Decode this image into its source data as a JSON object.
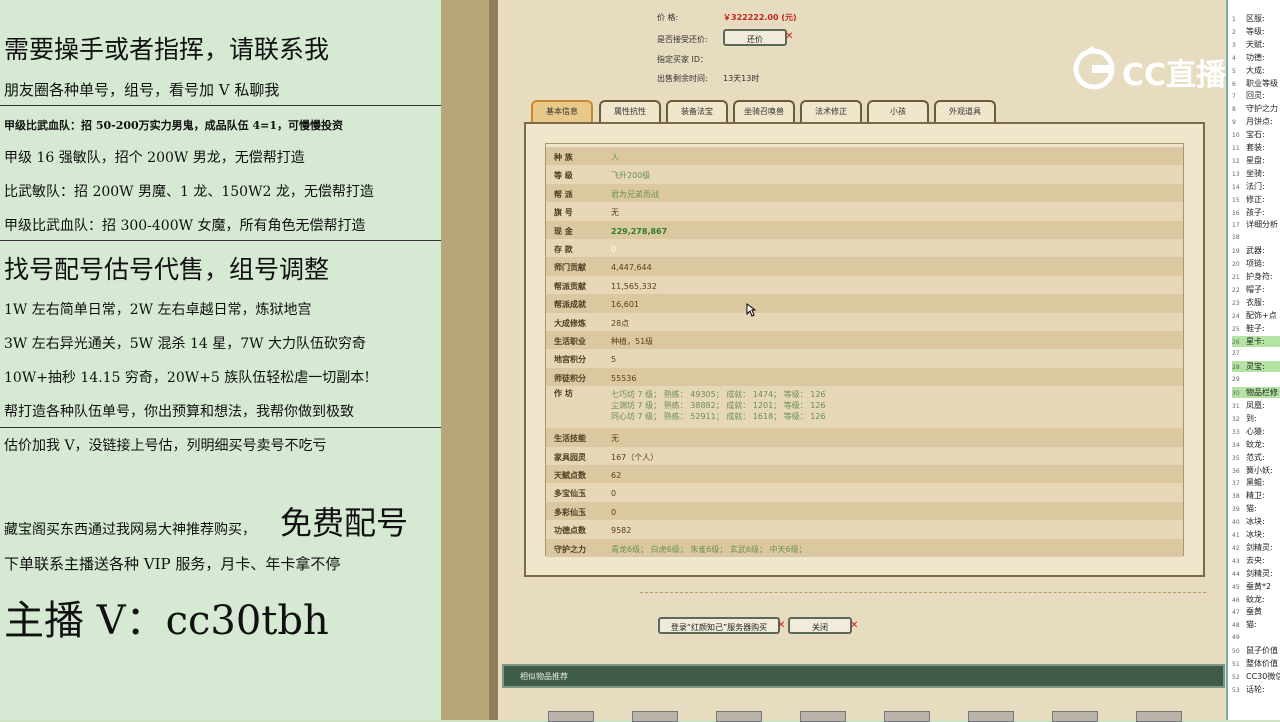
{
  "overlay": {
    "lines": [
      "需要操手或者指挥，请联系我",
      "朋友圈各种单号，组号，看号加 V 私聊我",
      "甲级比武血队：招 50-200万实力男鬼，成品队伍 4=1，可慢慢投资",
      "甲级 16 强敏队，招个 200W 男龙，无偿帮打造",
      "比武敏队：招 200W 男魔、1 龙、150W2 龙，无偿帮打造",
      "甲级比武血队：招 300-400W 女魔，所有角色无偿帮打造",
      "找号配号估号代售，组号调整",
      "1W 左右简单日常，2W 左右卓越日常，炼狱地宫",
      "3W 左右异光通关，5W 混杀 14 星，7W 大力队伍砍穷奇",
      "10W+抽秒 14.15 穷奇，20W+5 族队伍轻松虐一切副本!",
      "帮打造各种队伍单号，你出预算和想法，我帮你做到极致",
      "估价加我 V，没链接上号估，列明细买号卖号不吃亏",
      "藏宝阁买东西通过我网易大神推荐购买，",
      "免费配号",
      "下单联系主播送各种 VIP 服务，月卡、年卡拿不停",
      "主播 V：cc30tbh"
    ]
  },
  "trade": {
    "price_label": "价     格:",
    "price_value": "￥322222.00 (元)",
    "bargain_label": "是否接受还价:",
    "bargain_button": "还价",
    "buyer_label": "指定买家 ID：",
    "remaining_label": "出售剩余时间:",
    "remaining_value": "13天13时"
  },
  "tabs": [
    "基本信息",
    "属性抗性",
    "装备法宝",
    "坐骑召唤兽",
    "法术修正",
    "小孩",
    "外观道具"
  ],
  "info_rows": [
    {
      "k": "种    族",
      "v": "人"
    },
    {
      "k": "等    级",
      "v": "飞升200级"
    },
    {
      "k": "帮    派",
      "v": "君为兄弟而战"
    },
    {
      "k": "旗    号",
      "v": "无"
    },
    {
      "k": "现    金",
      "v": "229,278,867"
    },
    {
      "k": "存    款",
      "v": "0"
    },
    {
      "k": "师门贡献",
      "v": "4,447,644"
    },
    {
      "k": "帮派贡献",
      "v": "11,565,332"
    },
    {
      "k": "帮派成就",
      "v": "16,601"
    },
    {
      "k": "大成修炼",
      "v": "28点"
    },
    {
      "k": "生活职业",
      "v": "种植，51级"
    },
    {
      "k": "地宫积分",
      "v": "5"
    },
    {
      "k": "师徒积分",
      "v": "55536"
    },
    {
      "k": "作    坊",
      "v": "七巧坊 7 级； 熟练： 49305； 成就： 1474； 等级： 126\n尘渊坊 7 级； 熟练： 38882； 成就： 1201； 等级： 126\n同心坊 7 级； 熟练： 52911； 成就： 1618； 等级： 126"
    },
    {
      "k": "生活技能",
      "v": "无"
    },
    {
      "k": "家具园灵",
      "v": "167（个人）"
    },
    {
      "k": "天赋点数",
      "v": "62"
    },
    {
      "k": "多宝仙玉",
      "v": "0"
    },
    {
      "k": "多彩仙玉",
      "v": "0"
    },
    {
      "k": "功德点数",
      "v": "9582"
    },
    {
      "k": "守护之力",
      "v": "青龙6级； 白虎6级； 朱雀6级； 玄武6级； 中天6级；"
    }
  ],
  "buttons": {
    "login": "登录“红颜知己”服务器购买",
    "close": "关闭"
  },
  "similar_title": "相似物品推荐",
  "logo_text": "CC直播",
  "right_panel": [
    {
      "n": "1",
      "t": "区服:"
    },
    {
      "n": "2",
      "t": "等级:"
    },
    {
      "n": "3",
      "t": "天赋:"
    },
    {
      "n": "4",
      "t": "功德:"
    },
    {
      "n": "5",
      "t": "大成:"
    },
    {
      "n": "6",
      "t": "职业等级"
    },
    {
      "n": "7",
      "t": "回灵:"
    },
    {
      "n": "8",
      "t": "守护之力"
    },
    {
      "n": "9",
      "t": "月饼点:"
    },
    {
      "n": "10",
      "t": "宝石:"
    },
    {
      "n": "11",
      "t": "套装:"
    },
    {
      "n": "12",
      "t": "星盘:"
    },
    {
      "n": "13",
      "t": "坐骑:"
    },
    {
      "n": "14",
      "t": "法门:"
    },
    {
      "n": "15",
      "t": "修正:"
    },
    {
      "n": "16",
      "t": "孩子:"
    },
    {
      "n": "17",
      "t": "详细分析"
    },
    {
      "n": "18",
      "t": ""
    },
    {
      "n": "19",
      "t": "武器:"
    },
    {
      "n": "20",
      "t": "项链:"
    },
    {
      "n": "21",
      "t": "护身符:"
    },
    {
      "n": "22",
      "t": "帽子:"
    },
    {
      "n": "23",
      "t": "衣服:"
    },
    {
      "n": "24",
      "t": "配饰+点"
    },
    {
      "n": "25",
      "t": "鞋子:"
    },
    {
      "n": "26",
      "t": "星卡:"
    },
    {
      "n": "27",
      "t": ""
    },
    {
      "n": "28",
      "t": "灵宝:"
    },
    {
      "n": "29",
      "t": ""
    },
    {
      "n": "30",
      "t": "物品栏修"
    },
    {
      "n": "31",
      "t": "凤凰:"
    },
    {
      "n": "32",
      "t": "到:"
    },
    {
      "n": "33",
      "t": "心猿:"
    },
    {
      "n": "34",
      "t": "蚊龙:"
    },
    {
      "n": "35",
      "t": "范式:"
    },
    {
      "n": "36",
      "t": "簧小妖:"
    },
    {
      "n": "37",
      "t": "黑鲲:"
    },
    {
      "n": "38",
      "t": "精卫:"
    },
    {
      "n": "39",
      "t": "猫:"
    },
    {
      "n": "40",
      "t": "冰块:"
    },
    {
      "n": "41",
      "t": "冰块:"
    },
    {
      "n": "42",
      "t": "剑精灵:"
    },
    {
      "n": "43",
      "t": "去央:"
    },
    {
      "n": "44",
      "t": "剑精灵:"
    },
    {
      "n": "45",
      "t": "蚕黄*2"
    },
    {
      "n": "46",
      "t": "蚊龙:"
    },
    {
      "n": "47",
      "t": "蚕黄"
    },
    {
      "n": "48",
      "t": "猫:"
    },
    {
      "n": "49",
      "t": ""
    },
    {
      "n": "50",
      "t": "鼠子价值"
    },
    {
      "n": "51",
      "t": "整体价值"
    },
    {
      "n": "52",
      "t": "CC30微信"
    },
    {
      "n": "53",
      "t": "话轮:"
    }
  ],
  "colors": {
    "accent_green": "#2e6b3a",
    "header_bar": "#3e5b48",
    "value_green": "#2f7d2a",
    "active_tab": "#c7892a"
  }
}
